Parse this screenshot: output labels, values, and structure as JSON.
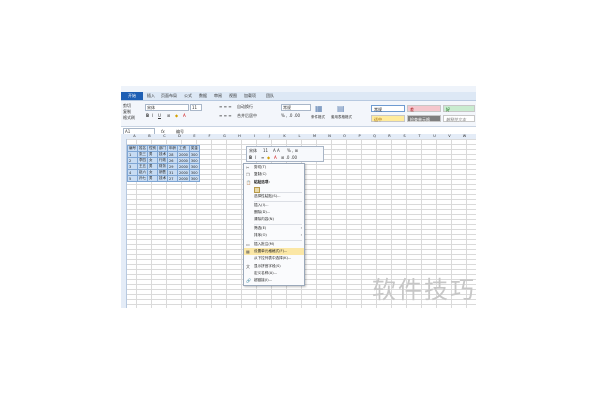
{
  "ribbon_tabs": [
    {
      "label": "开始"
    },
    {
      "label": "插入"
    },
    {
      "label": "页面布局"
    },
    {
      "label": "公式"
    },
    {
      "label": "数据"
    },
    {
      "label": "审阅"
    },
    {
      "label": "视图"
    },
    {
      "label": "加载项"
    },
    {
      "label": "团队"
    }
  ],
  "clipboard": {
    "cut": "剪切",
    "copy": "复制",
    "format_painter": "格式刷"
  },
  "font": {
    "name": "宋体",
    "size": "11"
  },
  "alignment": {
    "wrap": "自动换行",
    "merge": "合并后居中"
  },
  "number_format": "常规",
  "styles": {
    "normal": "常规",
    "bad": "差",
    "good": "好",
    "neutral": "适中",
    "calc": "计算",
    "check": "检查单元格",
    "explain": "解释性文本",
    "cond_format": "条件格式",
    "table_format": "套用表格格式"
  },
  "group_labels": {
    "clipboard": "剪贴板",
    "font": "字体",
    "alignment": "对齐方式",
    "number": "数字",
    "styles": "样式"
  },
  "formula_bar": {
    "name_box": "A1",
    "fx": "fx",
    "content": "编号"
  },
  "columns": [
    "A",
    "B",
    "C",
    "D",
    "E",
    "F",
    "G",
    "H",
    "I",
    "J",
    "K",
    "L",
    "M",
    "N",
    "O",
    "P",
    "Q",
    "R",
    "S",
    "T",
    "U",
    "V",
    "W"
  ],
  "table": {
    "header": [
      "编号",
      "姓名",
      "性别",
      "部门",
      "年龄",
      "工资",
      "奖金"
    ],
    "rows": [
      [
        "1",
        "张三",
        "男",
        "技术",
        "28",
        "2000",
        "300"
      ],
      [
        "2",
        "李四",
        "女",
        "行政",
        "26",
        "2000",
        "300"
      ],
      [
        "3",
        "王五",
        "男",
        "财务",
        "29",
        "2000",
        "300"
      ],
      [
        "4",
        "赵六",
        "女",
        "销售",
        "31",
        "2000",
        "300"
      ],
      [
        "5",
        "孙七",
        "男",
        "技术",
        "27",
        "2000",
        "300"
      ]
    ]
  },
  "mini_toolbar": {
    "font": "宋体",
    "size": "11"
  },
  "context_menu": [
    {
      "label": "剪切(T)",
      "icon": "scissors-icon"
    },
    {
      "label": "复制(C)",
      "icon": "copy-icon"
    },
    {
      "label": "粘贴选项:",
      "icon": "paste-icon",
      "header": true
    },
    {
      "label": "选择性粘贴(S)...",
      "icon": ""
    },
    {
      "label": "插入(I)...",
      "icon": ""
    },
    {
      "label": "删除(D)...",
      "icon": ""
    },
    {
      "label": "清除内容(N)",
      "icon": ""
    },
    {
      "label": "筛选(E)",
      "icon": "",
      "submenu": true
    },
    {
      "label": "排序(O)",
      "icon": "",
      "submenu": true
    },
    {
      "label": "插入批注(M)",
      "icon": "comment-icon"
    },
    {
      "label": "设置单元格格式(F)...",
      "icon": "format-cells-icon",
      "highlighted": true
    },
    {
      "label": "从下拉列表中选择(K)...",
      "icon": ""
    },
    {
      "label": "显示拼音字段(S)",
      "icon": "phonetic-icon"
    },
    {
      "label": "定义名称(A)...",
      "icon": ""
    },
    {
      "label": "超链接(I)...",
      "icon": "hyperlink-icon"
    }
  ],
  "watermark": "软件技巧"
}
